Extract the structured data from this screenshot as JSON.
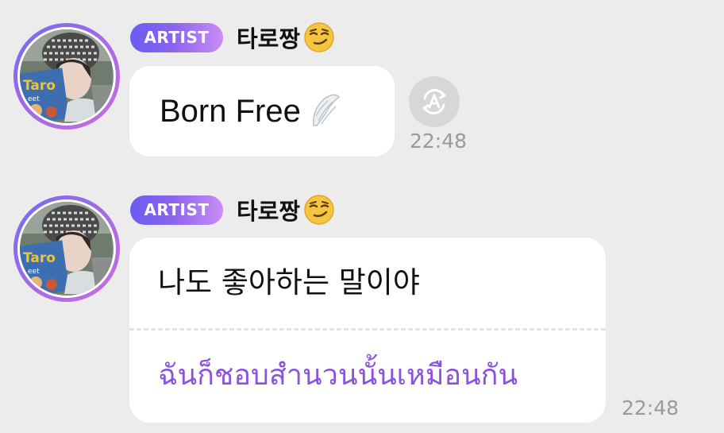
{
  "messages": [
    {
      "badge": "ARTIST",
      "sender": "타로짱",
      "sender_emoji": "smirking-face-emoji",
      "text": "Born Free",
      "text_emoji": "wing-emoji",
      "translate_icon": "auto-translate-icon",
      "time": "22:48"
    },
    {
      "badge": "ARTIST",
      "sender": "타로짱",
      "sender_emoji": "smirking-face-emoji",
      "text": "나도 좋아하는 말이야",
      "translation": "ฉันก็ชอบสำนวนนั้นเหมือนกัน",
      "time": "22:48"
    }
  ],
  "colors": {
    "background": "#ececed",
    "bubble": "#ffffff",
    "badge_gradient_start": "#6a5cf0",
    "badge_gradient_end": "#c88cf5",
    "translation_text": "#8a53dd",
    "timestamp": "#9a9a9d"
  }
}
